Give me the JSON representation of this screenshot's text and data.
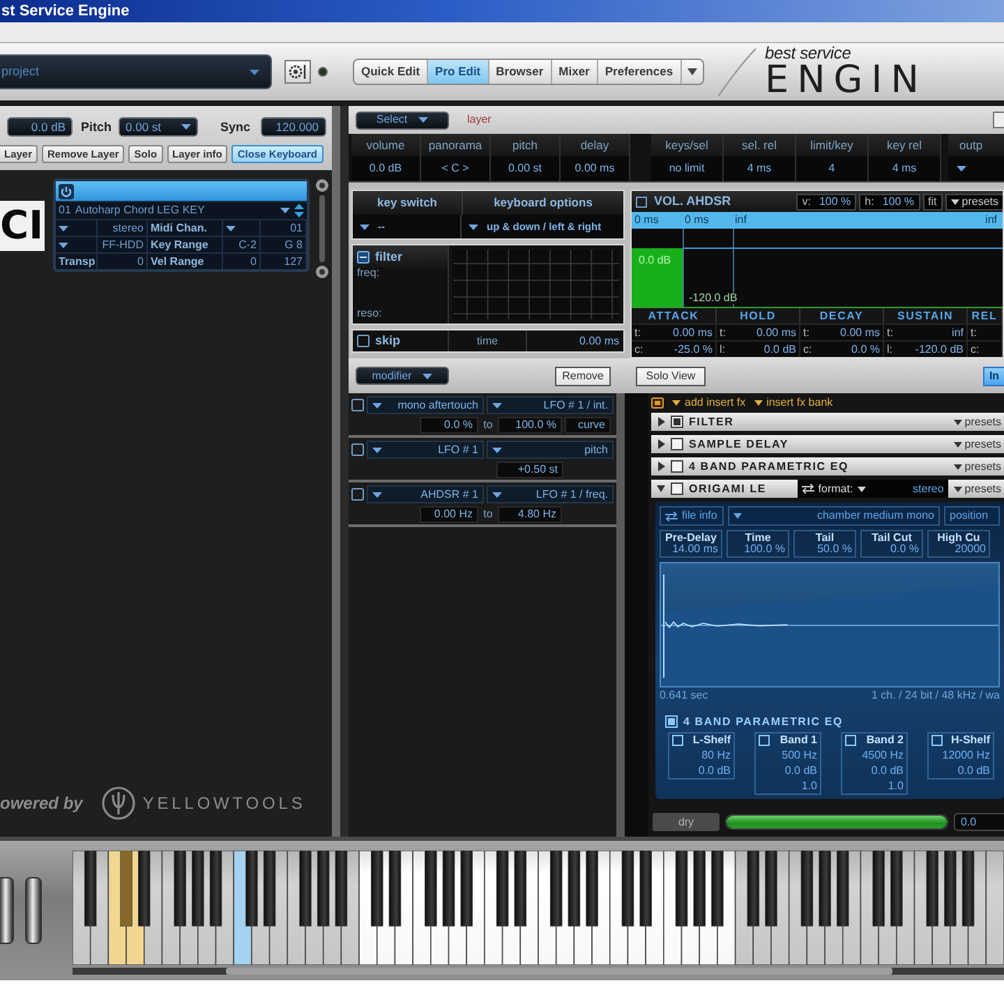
{
  "window": {
    "title": "st Service Engine"
  },
  "toolbar": {
    "project": "project",
    "tabs": [
      {
        "label": "Quick Edit",
        "selected": false
      },
      {
        "label": "Pro Edit",
        "selected": true
      },
      {
        "label": "Browser",
        "selected": false
      },
      {
        "label": "Mixer",
        "selected": false
      },
      {
        "label": "Preferences",
        "selected": false
      }
    ],
    "logo_top": "best service",
    "logo_bottom": "ENGIN"
  },
  "layer_panel": {
    "volume": "0.0 dB",
    "pitch_label": "Pitch",
    "pitch": "0.00 st",
    "sync_label": "Sync",
    "sync": "120.000",
    "buttons": [
      {
        "label": "Layer",
        "active": false
      },
      {
        "label": "Remove Layer",
        "active": false
      },
      {
        "label": "Solo",
        "active": false
      },
      {
        "label": "Layer info",
        "active": false
      },
      {
        "label": "Close Keyboard",
        "active": true
      }
    ],
    "logo": "CI",
    "layer": {
      "number": "01",
      "name": "Autoharp Chord LEG KEY",
      "rows": [
        {
          "cells": [
            {
              "kind": "menu"
            },
            {
              "kind": "value",
              "text": "stereo"
            },
            {
              "kind": "label",
              "text": "Midi Chan."
            },
            {
              "kind": "menu"
            },
            {
              "kind": "value",
              "text": "01"
            }
          ]
        },
        {
          "cells": [
            {
              "kind": "menu"
            },
            {
              "kind": "value",
              "text": "FF-HDD"
            },
            {
              "kind": "label",
              "text": "Key Range"
            },
            {
              "kind": "value",
              "text": "C-2"
            },
            {
              "kind": "value",
              "text": "G 8"
            }
          ]
        },
        {
          "cells": [
            {
              "kind": "label",
              "text": "Transp"
            },
            {
              "kind": "value",
              "text": "0"
            },
            {
              "kind": "label",
              "text": "Vel Range"
            },
            {
              "kind": "value",
              "text": "0"
            },
            {
              "kind": "value",
              "text": "127"
            }
          ]
        }
      ]
    },
    "powered_by": "owered by",
    "brand": "YELLOWTOOLS"
  },
  "edit_panel": {
    "select": "Select",
    "target": "layer",
    "param_groups": [
      {
        "params": [
          {
            "kind": "value",
            "label": "volume",
            "value": "0.0 dB"
          },
          {
            "kind": "value",
            "label": "panorama",
            "value": "< C >"
          },
          {
            "kind": "value",
            "label": "pitch",
            "value": "0.00 st"
          },
          {
            "kind": "value",
            "label": "delay",
            "value": "0.00 ms"
          }
        ]
      },
      {
        "params": [
          {
            "kind": "value",
            "label": "keys/sel",
            "value": "no limit"
          },
          {
            "kind": "value",
            "label": "sel. rel",
            "value": "4 ms"
          },
          {
            "kind": "value",
            "label": "limit/key",
            "value": "4"
          },
          {
            "kind": "value",
            "label": "key rel",
            "value": "4 ms"
          }
        ]
      },
      {
        "params": [
          {
            "kind": "menu",
            "label": "outp"
          }
        ]
      }
    ],
    "key_switch": {
      "title": "key switch",
      "value": "--",
      "options_title": "keyboard options",
      "options_value": "up & down / left & right"
    },
    "filter": {
      "title": "filter",
      "freq_label": "freq:",
      "reso_label": "reso:"
    },
    "skip": {
      "title": "skip",
      "time_label": "time",
      "time": "0.00 ms"
    },
    "envelope": {
      "title": "VOL. AHDSR",
      "v_label": "v:",
      "v": "100 %",
      "h_label": "h:",
      "h": "100 %",
      "fit": "fit",
      "presets": "presets",
      "ruler": [
        "0 ms",
        "0 ms",
        "inf",
        "inf"
      ],
      "peak": "0.0 dB",
      "floor": "-120.0 dB",
      "stages": [
        {
          "name": "ATTACK",
          "t_label": "t:",
          "t": "0.00 ms",
          "c_label": "c:",
          "c": "-25.0 %"
        },
        {
          "name": "HOLD",
          "t_label": "t:",
          "t": "0.00 ms",
          "c_label": "l:",
          "c": "0.0 dB"
        },
        {
          "name": "DECAY",
          "t_label": "t:",
          "t": "0.00 ms",
          "c_label": "c:",
          "c": "0.0 %"
        },
        {
          "name": "SUSTAIN",
          "t_label": "t:",
          "t": "inf",
          "c_label": "l:",
          "c": "-120.0 dB"
        },
        {
          "name": "REL",
          "t_label": "t:",
          "c_label": "c:"
        }
      ]
    },
    "modifier_bar": {
      "menu": "modifier",
      "remove": "Remove"
    },
    "modifiers": [
      {
        "kind": "range",
        "source": "mono aftertouch",
        "target": "LFO # 1 / int.",
        "from": "0.0 %",
        "to_label": "to",
        "to": "100.0 %",
        "curve": "curve"
      },
      {
        "kind": "amount",
        "source": "LFO # 1",
        "target": "pitch",
        "amount": "+0.50 st"
      },
      {
        "kind": "range",
        "source": "AHDSR # 1",
        "target": "LFO # 1 / freq.",
        "from": "0.00 Hz",
        "to_label": "to",
        "to": "4.80 Hz"
      }
    ],
    "fx": {
      "solo_view": "Solo View",
      "insert_button": "In",
      "add": "add insert fx",
      "bank": "insert fx bank",
      "inserts": [
        {
          "name": "FILTER",
          "enabled": true,
          "expanded": false,
          "presets": "presets"
        },
        {
          "name": "SAMPLE DELAY",
          "enabled": false,
          "expanded": false,
          "presets": "presets"
        },
        {
          "name": "4 BAND PARAMETRIC EQ",
          "enabled": false,
          "expanded": false,
          "presets": "presets"
        },
        {
          "name": "ORIGAMI LE",
          "enabled": false,
          "expanded": true,
          "format_label": "format:",
          "format": "stereo",
          "presets": "presets"
        }
      ],
      "reverb": {
        "file_info": "file info",
        "impulse": "chamber medium mono",
        "position": "position",
        "params": [
          {
            "label": "Pre-Delay",
            "value": "14.00 ms"
          },
          {
            "label": "Time",
            "value": "100.0 %"
          },
          {
            "label": "Tail",
            "value": "50.0 %"
          },
          {
            "label": "Tail Cut",
            "value": "0.0 %"
          },
          {
            "label": "High Cu",
            "value": "20000"
          }
        ],
        "length": "0.641 sec",
        "file_format": "1 ch. / 24 bit / 48 kHz / wa",
        "eq": {
          "title": "4 BAND PARAMETRIC EQ",
          "enabled": true,
          "bands": [
            {
              "name": "L-Shelf",
              "enabled": false,
              "freq": "80 Hz",
              "gain": "0.0 dB"
            },
            {
              "name": "Band 1",
              "enabled": false,
              "freq": "500 Hz",
              "gain": "0.0 dB",
              "q": "1.0"
            },
            {
              "name": "Band 2",
              "enabled": false,
              "freq": "4500 Hz",
              "gain": "0.0 dB",
              "q": "1.0"
            },
            {
              "name": "H-Shelf",
              "enabled": false,
              "freq": "12000 Hz",
              "gain": "0.0 dB"
            }
          ]
        }
      },
      "mix": {
        "label": "dry",
        "level": 1,
        "value": "0.0"
      }
    }
  },
  "keyboard": {
    "octaves": [
      {
        "kind": "partial",
        "in_range": false
      },
      {
        "kind": "full",
        "in_range": false,
        "keyswitch": true,
        "pressed": false
      },
      {
        "kind": "full",
        "in_range": false,
        "keyswitch": false,
        "pressed": true
      },
      {
        "kind": "full",
        "in_range": true,
        "keyswitch": false,
        "pressed": false
      },
      {
        "kind": "full",
        "in_range": true,
        "keyswitch": false,
        "pressed": false
      },
      {
        "kind": "full",
        "in_range": true,
        "keyswitch": false,
        "pressed": false
      },
      {
        "kind": "full",
        "in_range": false,
        "keyswitch": false,
        "pressed": false
      },
      {
        "kind": "full",
        "in_range": false,
        "keyswitch": false,
        "pressed": false
      },
      {
        "kind": "top",
        "in_range": false
      }
    ]
  }
}
